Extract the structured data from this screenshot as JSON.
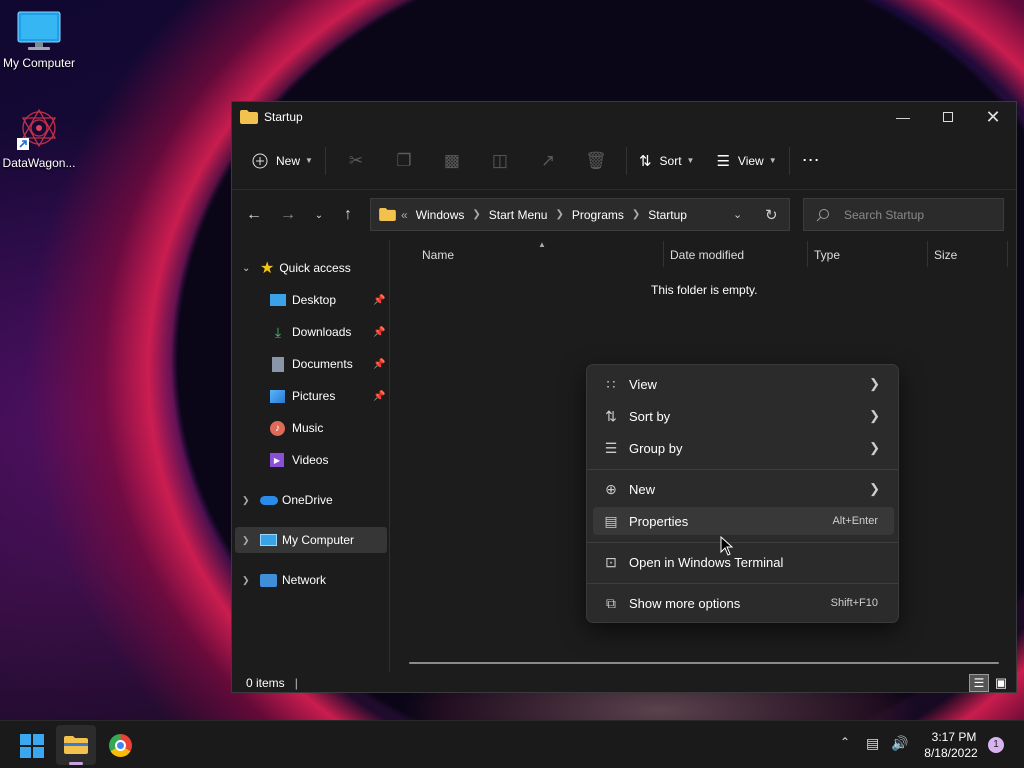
{
  "desktop": {
    "icons": [
      {
        "label": "My Computer"
      },
      {
        "label": "DataWagon..."
      }
    ]
  },
  "window": {
    "title": "Startup"
  },
  "toolbar": {
    "new_label": "New",
    "sort_label": "Sort",
    "view_label": "View"
  },
  "address": {
    "crumbs": [
      "Windows",
      "Start Menu",
      "Programs",
      "Startup"
    ],
    "search_placeholder": "Search Startup"
  },
  "nav": {
    "quick_access": "Quick access",
    "items": [
      "Desktop",
      "Downloads",
      "Documents",
      "Pictures",
      "Music",
      "Videos"
    ],
    "onedrive": "OneDrive",
    "my_computer": "My Computer",
    "network": "Network"
  },
  "columns": [
    "Name",
    "Date modified",
    "Type",
    "Size"
  ],
  "content": {
    "empty_message": "This folder is empty."
  },
  "status": {
    "items": "0 items"
  },
  "context_menu": {
    "view": "View",
    "sort_by": "Sort by",
    "group_by": "Group by",
    "new": "New",
    "properties": "Properties",
    "properties_shortcut": "Alt+Enter",
    "terminal": "Open in Windows Terminal",
    "more": "Show more options",
    "more_shortcut": "Shift+F10"
  },
  "taskbar": {
    "time": "3:17 PM",
    "date": "8/18/2022",
    "notification_count": "1"
  },
  "colors": {
    "folder": "#f2c14e",
    "accent": "#4cc2ff"
  }
}
